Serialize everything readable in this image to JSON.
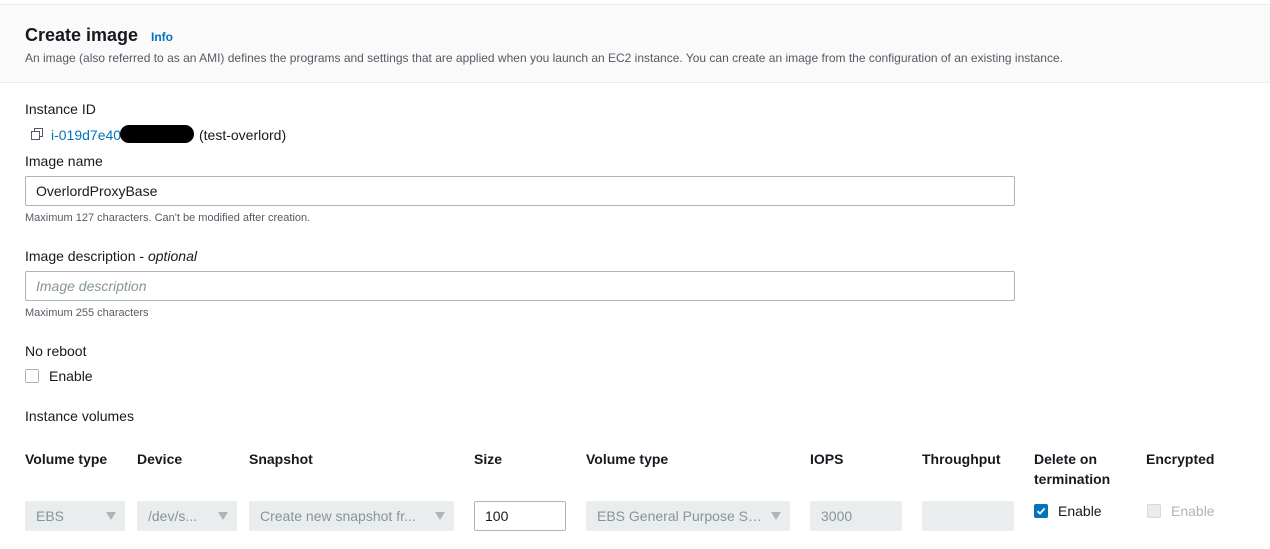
{
  "header": {
    "title": "Create image",
    "info_label": "Info",
    "description": "An image (also referred to as an AMI) defines the programs and settings that are applied when you launch an EC2 instance. You can create an image from the configuration of an existing instance."
  },
  "instance": {
    "label": "Instance ID",
    "id_text": "i-019d7e40",
    "name": "(test-overlord)"
  },
  "image_name": {
    "label": "Image name",
    "value": "OverlordProxyBase",
    "hint": "Maximum 127 characters. Can't be modified after creation."
  },
  "image_description": {
    "label": "Image description - ",
    "label_optional": "optional",
    "placeholder": "Image description",
    "hint": "Maximum 255 characters"
  },
  "no_reboot": {
    "label": "No reboot",
    "checkbox_label": "Enable",
    "checked": false
  },
  "volumes": {
    "label": "Instance volumes",
    "columns": [
      "Volume type",
      "Device",
      "Snapshot",
      "Size",
      "Volume type",
      "IOPS",
      "Throughput",
      "Delete on termination",
      "Encrypted"
    ],
    "row": {
      "volume_type": "EBS",
      "device": "/dev/s...",
      "snapshot": "Create new snapshot fr...",
      "size": "100",
      "ebs_type": "EBS General Purpose SS...",
      "iops": "3000",
      "throughput": "",
      "delete_on_termination_label": "Enable",
      "delete_on_termination_checked": true,
      "encrypted_label": "Enable",
      "encrypted_checked": false
    }
  },
  "colors": {
    "link": "#0073bb",
    "text": "#16191f",
    "muted": "#545b64",
    "disabled_bg": "#eaeded"
  }
}
